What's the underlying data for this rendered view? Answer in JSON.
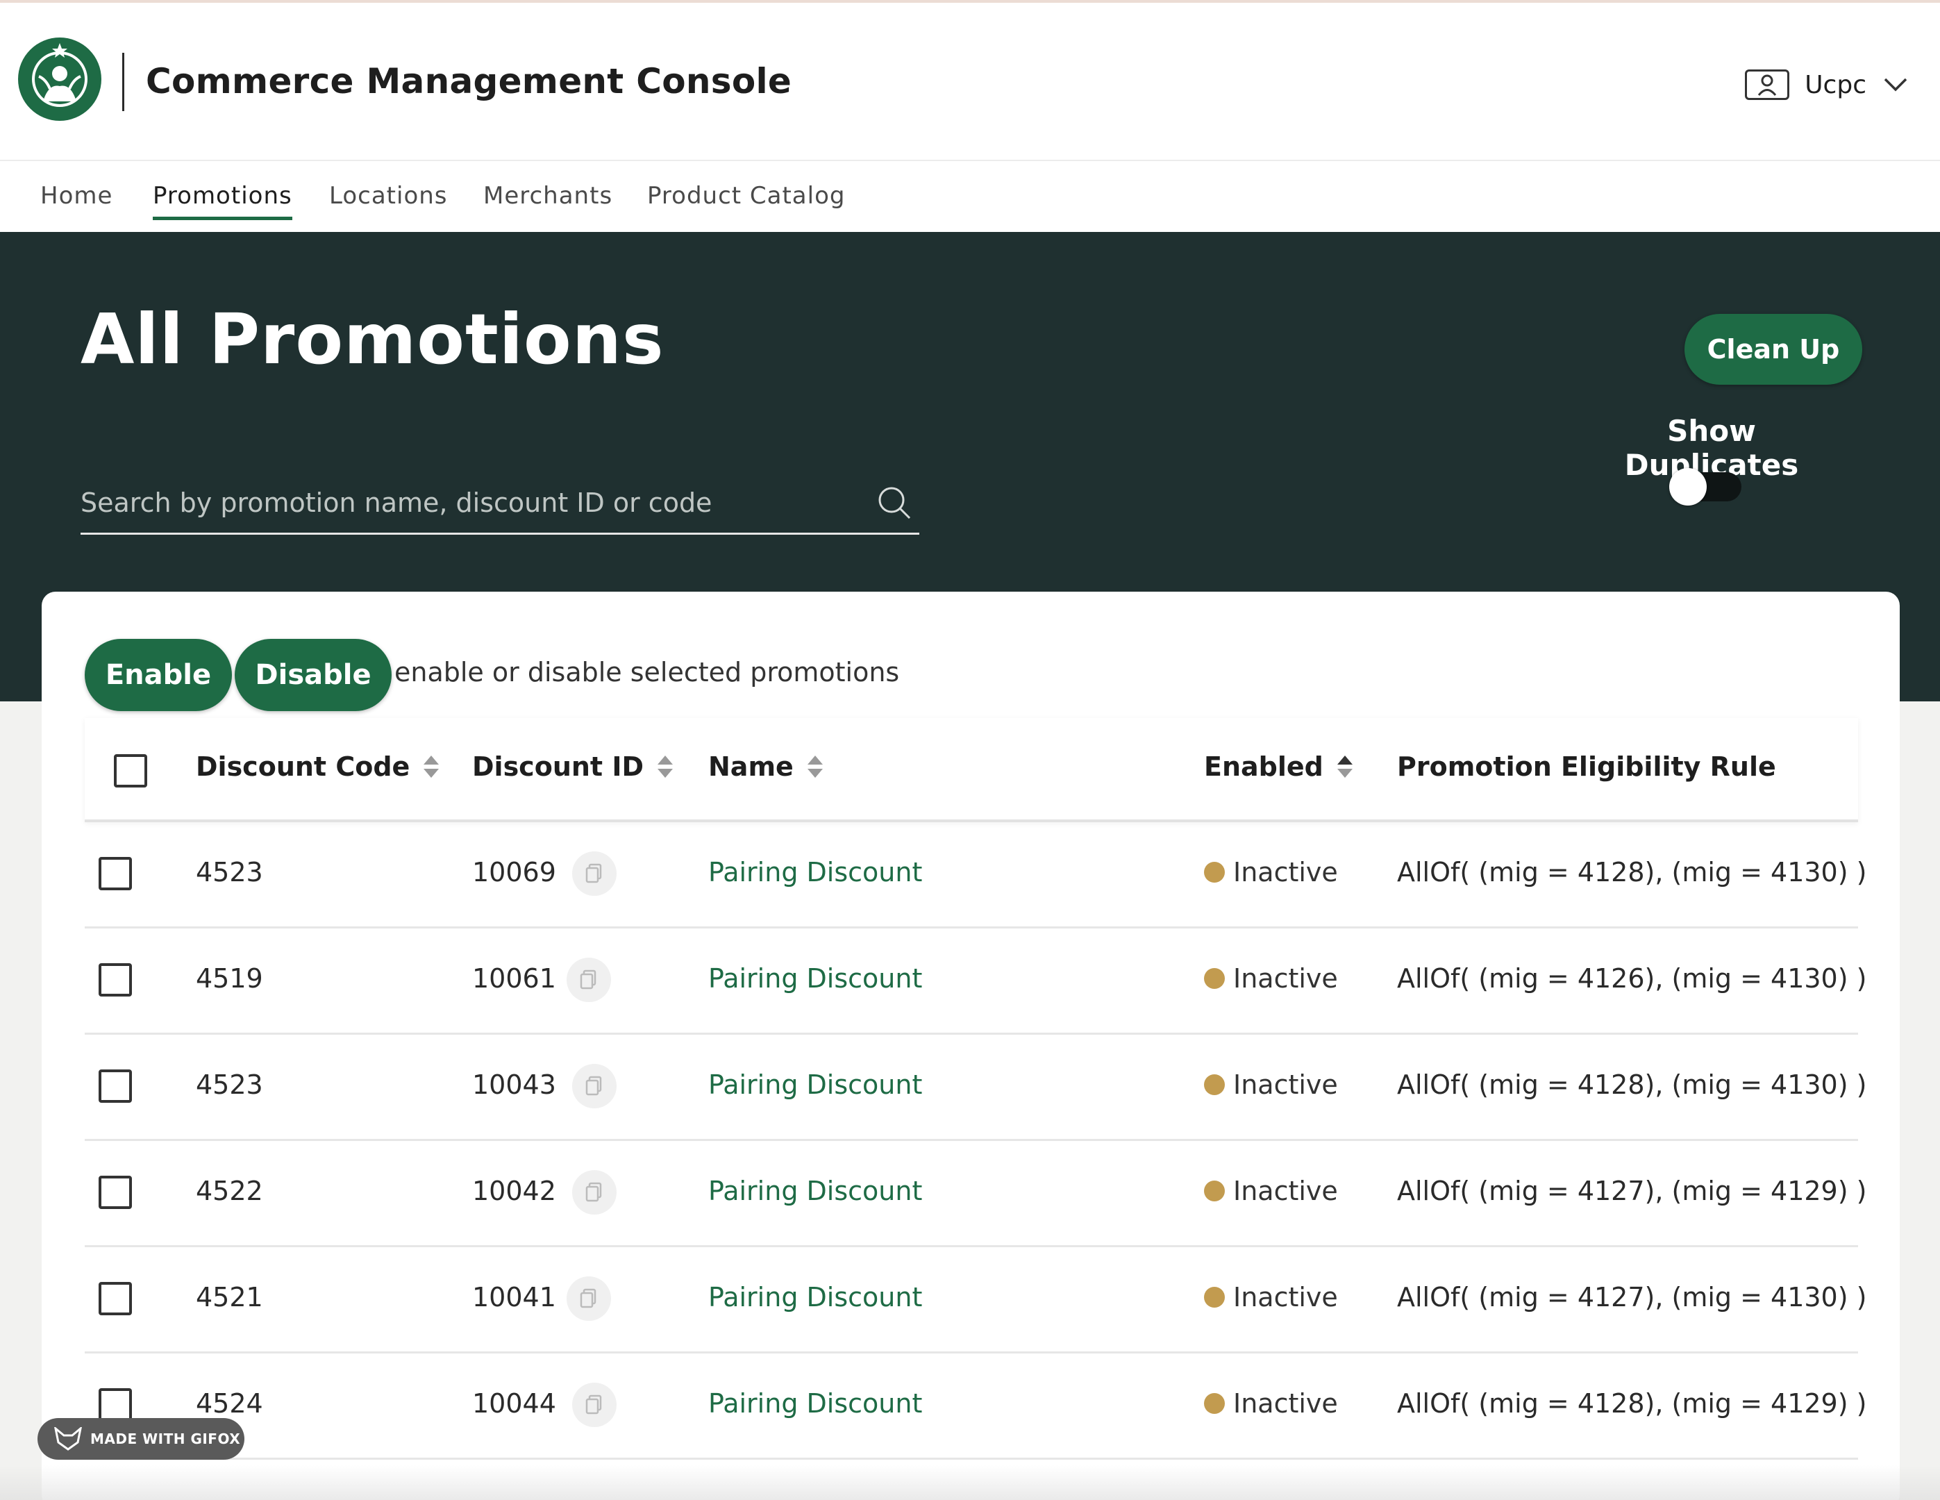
{
  "app": {
    "title": "Commerce Management Console",
    "user": "Ucpc"
  },
  "nav": [
    {
      "label": "Home",
      "active": false
    },
    {
      "label": "Promotions",
      "active": true
    },
    {
      "label": "Locations",
      "active": false
    },
    {
      "label": "Merchants",
      "active": false
    },
    {
      "label": "Product Catalog",
      "active": false
    }
  ],
  "hero": {
    "title": "All Promotions",
    "search_placeholder": "Search by promotion name, discount ID or code",
    "cleanup_label": "Clean Up",
    "duplicates_label": "Show Duplicates",
    "duplicates_on": false
  },
  "actions": {
    "enable_label": "Enable",
    "disable_label": "Disable",
    "hint": "enable or disable selected promotions"
  },
  "table": {
    "columns": [
      "Discount Code",
      "Discount ID",
      "Name",
      "Enabled",
      "Promotion Eligibility Rule"
    ],
    "rows": [
      {
        "code": "4523",
        "id": "10069",
        "name": "Pairing Discount",
        "status": "Inactive",
        "rule": "AllOf( (mig = 4128), (mig = 4130) )"
      },
      {
        "code": "4519",
        "id": "10061",
        "name": "Pairing Discount",
        "status": "Inactive",
        "rule": "AllOf( (mig = 4126), (mig = 4130) )"
      },
      {
        "code": "4523",
        "id": "10043",
        "name": "Pairing Discount",
        "status": "Inactive",
        "rule": "AllOf( (mig = 4128), (mig = 4130) )"
      },
      {
        "code": "4522",
        "id": "10042",
        "name": "Pairing Discount",
        "status": "Inactive",
        "rule": "AllOf( (mig = 4127), (mig = 4129) )"
      },
      {
        "code": "4521",
        "id": "10041",
        "name": "Pairing Discount",
        "status": "Inactive",
        "rule": "AllOf( (mig = 4127), (mig = 4130) )"
      },
      {
        "code": "4524",
        "id": "10044",
        "name": "Pairing Discount",
        "status": "Inactive",
        "rule": "AllOf( (mig = 4128), (mig = 4129) )"
      }
    ]
  },
  "badge": {
    "label": "MADE WITH GIFOX"
  },
  "colors": {
    "brand": "#1e6b45",
    "hero_bg": "#1f3030",
    "inactive_dot": "#c29b4f"
  }
}
